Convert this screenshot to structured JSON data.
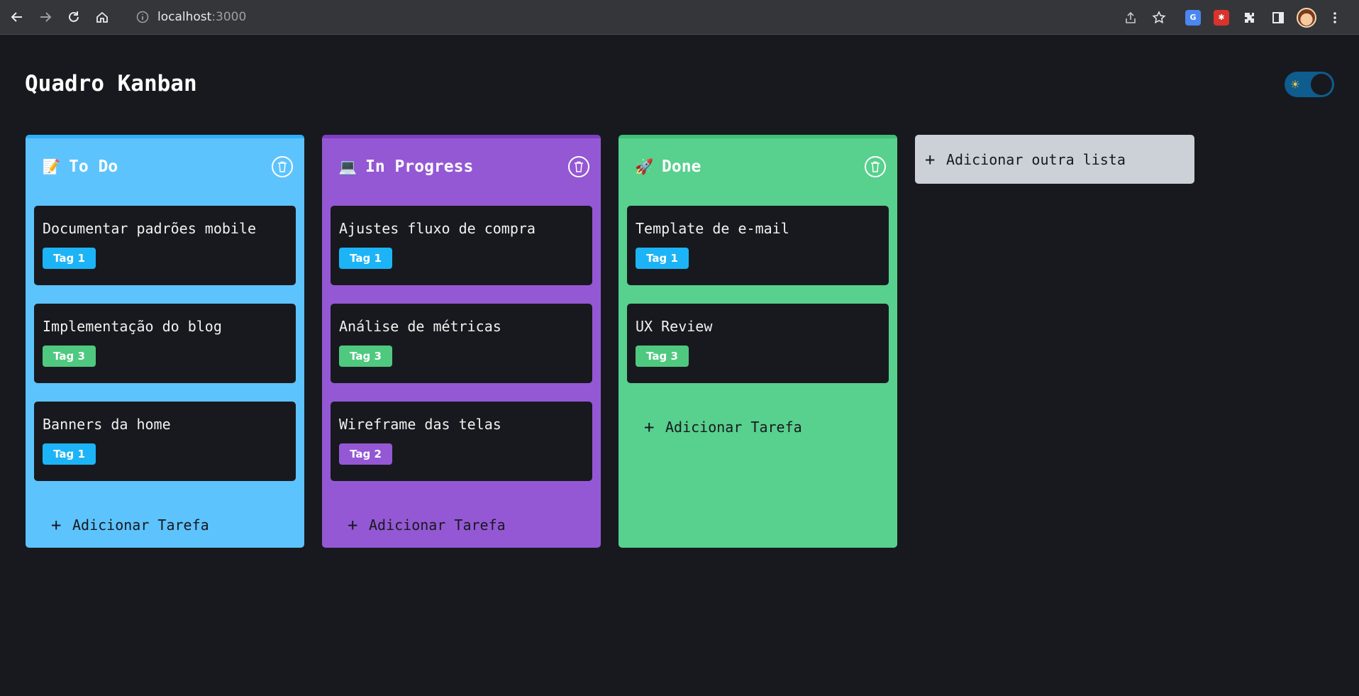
{
  "browser": {
    "host": "localhost",
    "port": ":3000",
    "icons": {
      "back": "back-arrow-icon",
      "forward": "forward-arrow-icon",
      "reload": "reload-icon",
      "home": "home-icon",
      "info": "info-icon",
      "share": "share-icon",
      "bookmark": "star-icon",
      "translate": "translate-extension-icon",
      "ext2": "red-extension-icon",
      "extensions": "puzzle-icon",
      "sidepanel": "side-panel-icon",
      "profile": "profile-avatar",
      "menu": "kebab-menu-icon"
    }
  },
  "app": {
    "title": "Quadro Kanban",
    "theme_toggle": {
      "icon": "sun-icon",
      "glyph": "☀"
    }
  },
  "columns": [
    {
      "icon": "📝",
      "title": "To Do",
      "color": "#5dc3fd",
      "cards": [
        {
          "title": "Documentar padrões mobile",
          "tag": "Tag 1",
          "tag_color": "#1cb4f7"
        },
        {
          "title": "Implementação do blog",
          "tag": "Tag 3",
          "tag_color": "#4fc97f"
        },
        {
          "title": "Banners da home",
          "tag": "Tag 1",
          "tag_color": "#1cb4f7"
        }
      ],
      "add_label": "Adicionar Tarefa"
    },
    {
      "icon": "💻",
      "title": "In Progress",
      "color": "#9458d4",
      "cards": [
        {
          "title": "Ajustes fluxo de compra",
          "tag": "Tag 1",
          "tag_color": "#1cb4f7"
        },
        {
          "title": "Análise de métricas",
          "tag": "Tag 3",
          "tag_color": "#4fc97f"
        },
        {
          "title": "Wireframe das telas",
          "tag": "Tag 2",
          "tag_color": "#9458d4"
        }
      ],
      "add_label": "Adicionar Tarefa"
    },
    {
      "icon": "🚀",
      "title": "Done",
      "color": "#58d08e",
      "cards": [
        {
          "title": "Template de e-mail",
          "tag": "Tag 1",
          "tag_color": "#1cb4f7"
        },
        {
          "title": "UX Review",
          "tag": "Tag 3",
          "tag_color": "#4fc97f"
        }
      ],
      "add_label": "Adicionar Tarefa"
    }
  ],
  "add_list": {
    "label": "Adicionar outra lista"
  },
  "plus_glyph": "+"
}
